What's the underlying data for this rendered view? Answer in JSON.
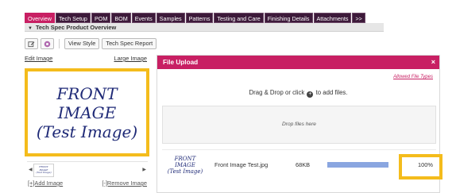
{
  "tabs": [
    {
      "label": "Overview",
      "active": true
    },
    {
      "label": "Tech Setup",
      "active": false
    },
    {
      "label": "POM",
      "active": false
    },
    {
      "label": "BOM",
      "active": false
    },
    {
      "label": "Events",
      "active": false
    },
    {
      "label": "Samples",
      "active": false
    },
    {
      "label": "Patterns",
      "active": false
    },
    {
      "label": "Testing and Care",
      "active": false
    },
    {
      "label": "Finishing Details",
      "active": false
    },
    {
      "label": "Attachments",
      "active": false
    },
    {
      "label": ">>",
      "active": false
    }
  ],
  "section": {
    "title": "Tech Spec Product Overview"
  },
  "toolbar": {
    "edit_icon": "edit-icon",
    "settings_icon": "gear-icon",
    "view_style": "View Style",
    "tech_spec_report": "Tech Spec Report"
  },
  "image_panel": {
    "edit_image": "Edit Image",
    "large_image": "Large Image",
    "front_image_text": "FRONT\nIMAGE\n(Test Image)",
    "thumb_text": "FRONT\nIMAGE\n(Test Image)",
    "add_image": "[+]Add Image",
    "remove_image": "[-]Remove Image"
  },
  "dialog": {
    "title": "File Upload",
    "close": "×",
    "allowed_types": "Allowed File Types",
    "drag_prefix": "Drag & Drop or click",
    "drag_suffix": "to add files.",
    "drop_hint": "Drop files here",
    "file": {
      "thumb_text": "FRONT\nIMAGE\n(Test Image)",
      "name": "Front Image Test.jpg",
      "size": "68KB",
      "progress": 1.0,
      "percent": "100%"
    }
  },
  "colors": {
    "accent": "#c81f63",
    "tab_dark": "#3d1a3a",
    "highlight": "#f4bc1c",
    "progress": "#8aa6e0"
  }
}
